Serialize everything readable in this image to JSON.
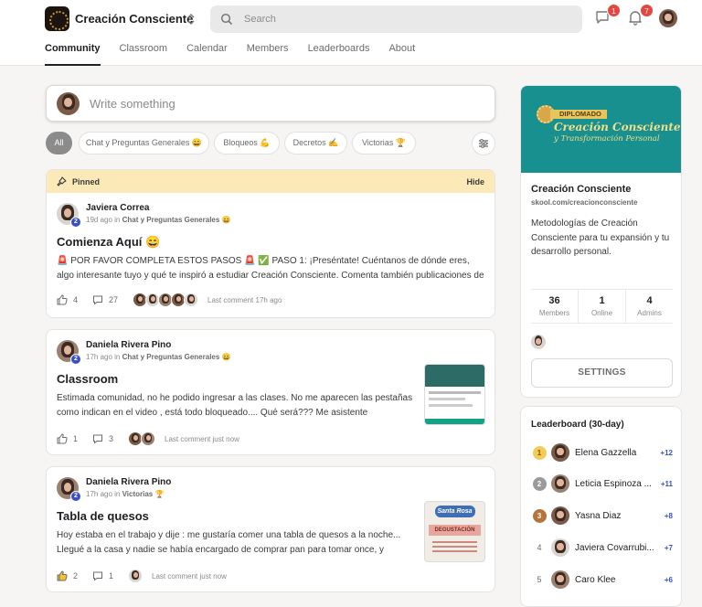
{
  "header": {
    "group_name": "Creación Consciente",
    "search_placeholder": "Search",
    "chat_badge": "1",
    "notif_badge": "7"
  },
  "tabs": [
    "Community",
    "Classroom",
    "Calendar",
    "Members",
    "Leaderboards",
    "About"
  ],
  "composer": {
    "placeholder": "Write something"
  },
  "filters": [
    "All",
    "Chat y Preguntas Generales 😄",
    "Bloqueos 💪",
    "Decretos ✍️",
    "Victorias 🏆"
  ],
  "posts": [
    {
      "pinned_label": "Pinned",
      "hide_label": "Hide",
      "author": "Javiera Correa",
      "level": "2",
      "time": "19d ago in",
      "category": "Chat y Preguntas Generales 😄",
      "title": "Comienza Aquí 😄",
      "body": "🚨 POR FAVOR COMPLETA ESTOS PASOS 🚨 ✅ PASO 1: ¡Preséntate! Cuéntanos de dónde eres, algo interesante tuyo y qué te inspiró a estudiar Creación Consciente. Comenta también publicaciones de",
      "likes": "4",
      "comments": "27",
      "last_comment": "Last comment 17h ago"
    },
    {
      "author": "Daniela Rivera Pino",
      "level": "2",
      "time": "17h ago in",
      "category": "Chat y Preguntas Generales 😄",
      "title": "Classroom",
      "body": "Estimada comunidad, no he podido ingresar a las clases. No me aparecen las pestañas como indican en el video , está todo bloqueado.... Qué será??? Me asistente",
      "likes": "1",
      "comments": "3",
      "last_comment": "Last comment just now"
    },
    {
      "author": "Daniela Rivera Pino",
      "level": "2",
      "time": "17h ago in",
      "category": "Victorias 🏆",
      "title": "Tabla de quesos",
      "body": "Hoy estaba en el trabajo y dije : me gustaría comer una tabla de quesos a la noche... Llegué a la casa y nadie se había encargado de comprar pan para tomar once, y",
      "likes": "2",
      "comments": "1",
      "last_comment": "Last comment just now",
      "thumb_brand": "Santa Rosa",
      "thumb_label": "DEGUSTACIÓN"
    }
  ],
  "group": {
    "cover_tag": "DIPLOMADO",
    "cover_title": "Creación Consciente",
    "cover_subtitle": "y Transformación Personal",
    "name": "Creación Consciente",
    "url": "skool.com/creacionconsciente",
    "description": "Metodologías de Creación Consciente para tu expansión y tu desarrollo personal.",
    "stats": [
      {
        "value": "36",
        "label": "Members"
      },
      {
        "value": "1",
        "label": "Online"
      },
      {
        "value": "4",
        "label": "Admins"
      }
    ],
    "settings_label": "SETTINGS"
  },
  "leaderboard": {
    "title": "Leaderboard (30-day)",
    "rows": [
      {
        "rank": "1",
        "name": "Elena Gazzella",
        "points": "+12"
      },
      {
        "rank": "2",
        "name": "Leticia Espinoza ...",
        "points": "+11"
      },
      {
        "rank": "3",
        "name": "Yasna Diaz",
        "points": "+8"
      },
      {
        "rank": "4",
        "name": "Javiera Covarrubi...",
        "points": "+7"
      },
      {
        "rank": "5",
        "name": "Caro Klee",
        "points": "+6"
      }
    ]
  }
}
